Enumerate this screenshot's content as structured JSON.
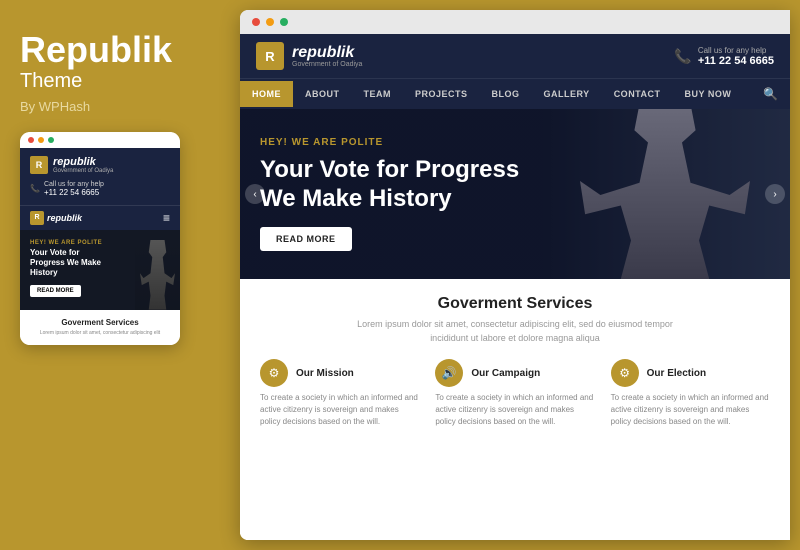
{
  "left": {
    "title": "Republik",
    "subtitle": "Theme",
    "by": "By WPHash",
    "dots": [
      "red",
      "yellow",
      "green"
    ],
    "mobile": {
      "logo_badge": "R",
      "logo_name": "republik",
      "logo_tagline": "Government of Oadiya",
      "phone_label": "Call us for any help",
      "phone_number": "+11 22 54 6665",
      "nav_logo_badge": "R",
      "nav_logo_name": "republik",
      "hamburger": "≡",
      "hero_tag": "HEY! WE ARE POLITE",
      "hero_btn": "READ MORE",
      "services_title": "Goverment Services"
    }
  },
  "right": {
    "browser_dots": [
      "red",
      "yellow",
      "green"
    ],
    "header": {
      "logo_badge": "R",
      "logo_name": "republik",
      "logo_tagline": "Government of Oadiya",
      "phone_label": "Call us for any help",
      "phone_number": "+11 22 54 6665"
    },
    "nav": {
      "items": [
        "HOME",
        "ABOUT",
        "TEAM",
        "PROJECTS",
        "BLOG",
        "GALLERY",
        "CONTACT",
        "BUY NOW"
      ],
      "active": "HOME"
    },
    "hero": {
      "tag": "HEY! WE ARE POLITE",
      "title_line1": "Your Vote for Progress",
      "title_line2": "We Make History",
      "btn": "READ MORE"
    },
    "services": {
      "title": "Goverment Services",
      "desc_line1": "Lorem ipsum dolor sit amet, consectetur adipiscing elit, sed do eiusmod tempor",
      "desc_line2": "incididunt ut labore et dolore magna aliqua",
      "items": [
        {
          "icon": "⚙",
          "name": "Our Mission",
          "text": "To create a society in which an informed and active citizenry is sovereign and makes policy decisions based on the will."
        },
        {
          "icon": "🔊",
          "name": "Our Campaign",
          "text": "To create a society in which an informed and active citizenry is sovereign and makes policy decisions based on the will."
        },
        {
          "icon": "⚙",
          "name": "Our Election",
          "text": "To create a society in which an informed and active citizenry is sovereign and makes policy decisions based on the will."
        }
      ]
    }
  }
}
